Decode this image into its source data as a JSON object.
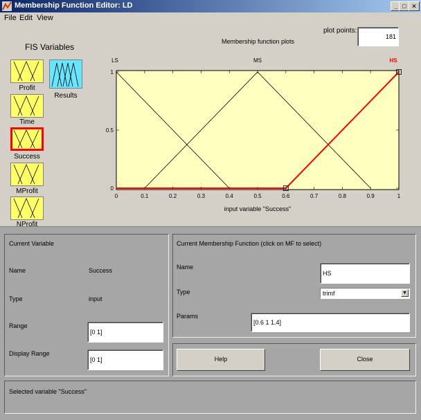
{
  "window": {
    "title": "Membership Function Editor: LD",
    "buttons": {
      "minimize": "_",
      "maximize": "□",
      "close": "✕"
    }
  },
  "menu": [
    "File",
    "Edit",
    "View"
  ],
  "fis": {
    "header": "FIS Variables",
    "inputs": [
      "Profit",
      "Time",
      "Success",
      "MProfit",
      "NProfit"
    ],
    "outputs": [
      "Results"
    ],
    "selected": "Success"
  },
  "plot": {
    "points_label": "plot points:",
    "points_value": "181",
    "title": "Membership function plots"
  },
  "chart_data": {
    "type": "line",
    "title": "Membership function plots",
    "xlabel": "input variable \"Success\"",
    "ylabel": "",
    "xlim": [
      0,
      1
    ],
    "ylim": [
      0,
      1
    ],
    "xticks": [
      "0",
      "0.1",
      "0.2",
      "0.3",
      "0.4",
      "0.5",
      "0.6",
      "0.7",
      "0.8",
      "0.9",
      "1"
    ],
    "yticks": [
      "0",
      "0.5",
      "1"
    ],
    "series": [
      {
        "name": "LS",
        "color": "#000000",
        "x": [
          0,
          0,
          0.4
        ],
        "y": [
          1,
          1,
          0
        ]
      },
      {
        "name": "MS",
        "color": "#000000",
        "x": [
          0.1,
          0.5,
          0.9
        ],
        "y": [
          0,
          1,
          0
        ]
      },
      {
        "name": "HS",
        "color": "#ff0000",
        "selected": true,
        "x": [
          0,
          0.6,
          1,
          1
        ],
        "y": [
          0,
          0,
          1,
          1
        ]
      }
    ],
    "background": "#ffffc0"
  },
  "current_variable": {
    "header": "Current Variable",
    "name_label": "Name",
    "name_value": "Success",
    "type_label": "Type",
    "type_value": "input",
    "range_label": "Range",
    "range_value": "[0 1]",
    "display_range_label": "Display Range",
    "display_range_value": "[0 1]"
  },
  "current_mf": {
    "header": "Current Membership Function (click on MF to select)",
    "name_label": "Name",
    "name_value": "HS",
    "type_label": "Type",
    "type_value": "trimf",
    "params_label": "Params",
    "params_value": "[0.6 1 1.4]"
  },
  "buttons": {
    "help": "Help",
    "close": "Close"
  },
  "status": "Selected variable \"Success\""
}
